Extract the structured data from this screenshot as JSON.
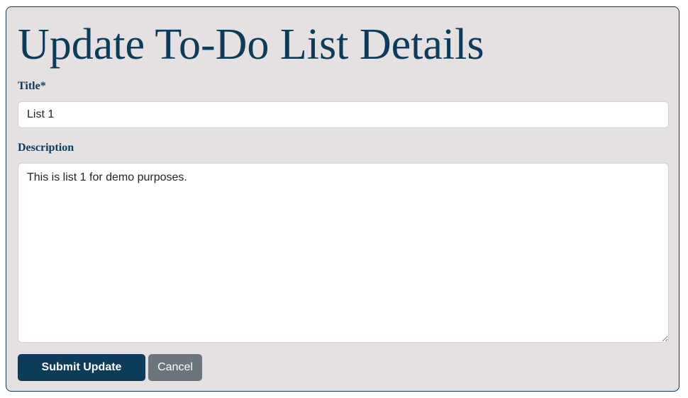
{
  "page": {
    "title": "Update To-Do List Details"
  },
  "form": {
    "title_label": "Title*",
    "title_value": "List 1",
    "description_label": "Description",
    "description_value": "This is list 1 for demo purposes."
  },
  "actions": {
    "submit_label": "Submit Update",
    "cancel_label": "Cancel"
  },
  "colors": {
    "primary": "#0d3b5a",
    "card_background": "#e5e0e1",
    "secondary_button": "#6c757d"
  }
}
